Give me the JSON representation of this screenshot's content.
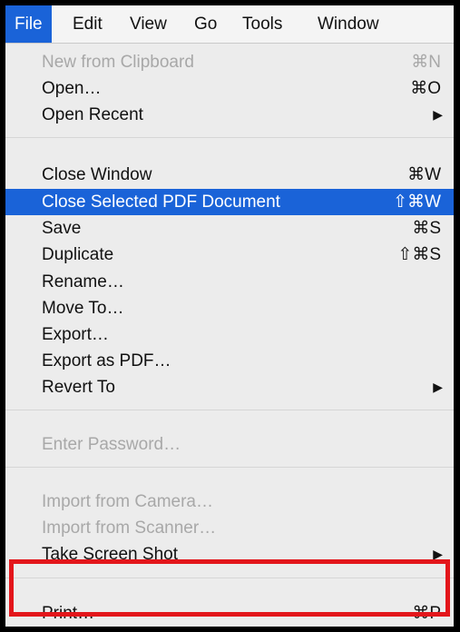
{
  "menubar": {
    "items": [
      "File",
      "Edit",
      "View",
      "Go",
      "Tools",
      "Window"
    ]
  },
  "menu": {
    "new_from_clipboard": {
      "label": "New from Clipboard",
      "shortcut": "⌘N"
    },
    "open": {
      "label": "Open…",
      "shortcut": "⌘O"
    },
    "open_recent": {
      "label": "Open Recent"
    },
    "close_window": {
      "label": "Close Window",
      "shortcut": "⌘W"
    },
    "close_selected_pdf": {
      "label": "Close Selected PDF Document",
      "shortcut": "⇧⌘W"
    },
    "save": {
      "label": "Save",
      "shortcut": "⌘S"
    },
    "duplicate": {
      "label": "Duplicate",
      "shortcut": "⇧⌘S"
    },
    "rename": {
      "label": "Rename…"
    },
    "move_to": {
      "label": "Move To…"
    },
    "export": {
      "label": "Export…"
    },
    "export_as_pdf": {
      "label": "Export as PDF…"
    },
    "revert_to": {
      "label": "Revert To"
    },
    "enter_password": {
      "label": "Enter Password…"
    },
    "import_from_camera": {
      "label": "Import from Camera…"
    },
    "import_from_scanner": {
      "label": "Import from Scanner…"
    },
    "take_screen_shot": {
      "label": "Take Screen Shot"
    },
    "print": {
      "label": "Print…",
      "shortcut": "⌘P"
    }
  },
  "colors": {
    "selection": "#1a63d8",
    "annotation_box": "#e3161b",
    "disabled_text": "#a8a8a8"
  },
  "icons": {
    "submenu": "▶"
  }
}
